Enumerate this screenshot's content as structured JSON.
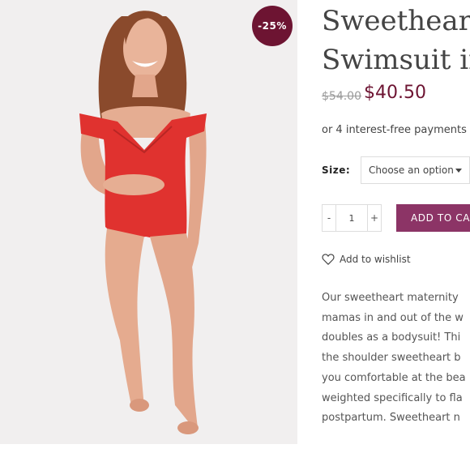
{
  "product": {
    "discount_badge": "-25%",
    "title_lines": [
      "Sweetheart",
      "Swimsuit in"
    ],
    "price_old": "$54.00",
    "price_new": "$40.50",
    "installments": "or 4 interest-free payments",
    "size_label": "Size:",
    "size_select": "Choose an option",
    "quantity": "1",
    "qty_minus": "-",
    "qty_plus": "+",
    "add_to_cart": "ADD TO CART",
    "wishlist": "Add to wishlist",
    "description_lines": [
      "Our sweetheart maternity",
      "mamas in and out of the w",
      "doubles as a bodysuit! Thi",
      "the shoulder sweetheart b",
      "you comfortable at the bea",
      "weighted specifically to fla",
      "postpartum. Sweetheart n"
    ]
  },
  "icons": {
    "wishlist": "heart-icon",
    "select": "chevron-down-icon"
  },
  "colors": {
    "badge": "#6d1432",
    "price": "#6d1432",
    "button": "#8c3466",
    "swimsuit": "#e0322f"
  }
}
